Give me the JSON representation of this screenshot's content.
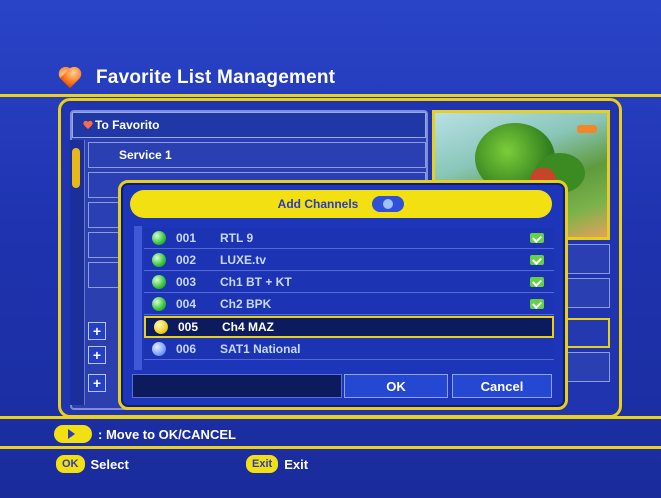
{
  "window": {
    "title": "Favorite List Management"
  },
  "favorite_list": {
    "header": "To Favorito",
    "first_service": "Service 1"
  },
  "dialog": {
    "title": "Add Channels",
    "channels": [
      {
        "number": "001",
        "name": "RTL 9",
        "checked": true,
        "selected": false
      },
      {
        "number": "002",
        "name": "LUXE.tv",
        "checked": true,
        "selected": false
      },
      {
        "number": "003",
        "name": "Ch1 BT + KT",
        "checked": true,
        "selected": false
      },
      {
        "number": "004",
        "name": "Ch2 BPK",
        "checked": true,
        "selected": false
      },
      {
        "number": "005",
        "name": "Ch4 MAZ",
        "checked": false,
        "selected": true
      },
      {
        "number": "006",
        "name": "SAT1 National",
        "checked": false,
        "selected": false
      }
    ],
    "ok_label": "OK",
    "cancel_label": "Cancel"
  },
  "hints": {
    "move": ": Move to OK/CANCEL",
    "ok_key": "OK",
    "ok_action": "Select",
    "exit_key": "Exit",
    "exit_action": "Exit"
  },
  "colors": {
    "background": "#2239b8",
    "accent_yellow": "#e8cf1c",
    "channel_green": "#34c23a"
  }
}
